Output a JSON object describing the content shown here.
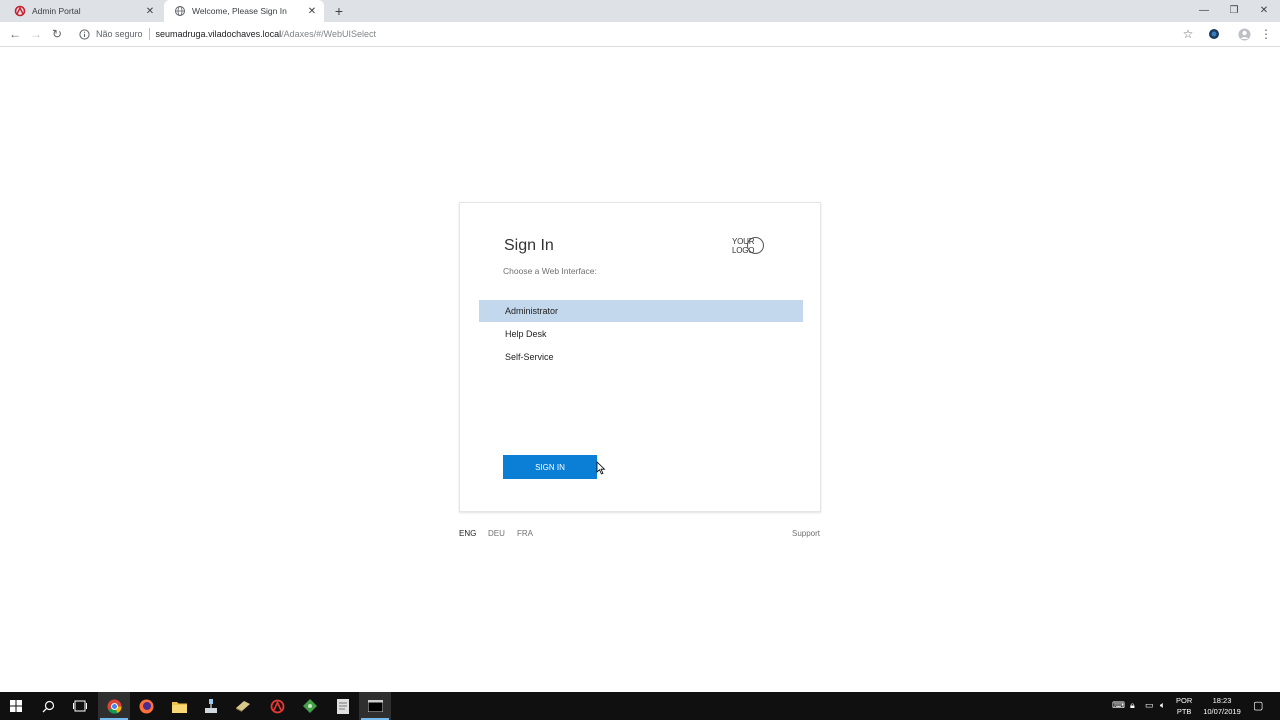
{
  "browser": {
    "tabs": [
      {
        "label": "Admin Portal",
        "icon": "adaxes-icon",
        "active": false
      },
      {
        "label": "Welcome, Please Sign In",
        "icon": "globe-icon",
        "active": true
      }
    ],
    "address": {
      "security_label": "Não seguro",
      "host": "seumadruga.viladochaves.local",
      "path": "/Adaxes/#/WebUISelect"
    }
  },
  "signin": {
    "title": "Sign In",
    "subtitle": "Choose a Web Interface:",
    "logo_text": "YOUR LOGO",
    "options": [
      {
        "label": "Administrator",
        "selected": true
      },
      {
        "label": "Help Desk",
        "selected": false
      },
      {
        "label": "Self-Service",
        "selected": false
      }
    ],
    "button_label": "SIGN IN",
    "selection_color": "#c3d8ec",
    "button_color": "#0b7fd6"
  },
  "footer": {
    "languages": [
      "ENG",
      "DEU",
      "FRA"
    ],
    "active_language": "ENG",
    "support_label": "Support"
  },
  "taskbar": {
    "input_language": [
      "POR",
      "PTB"
    ],
    "time": "18:23",
    "date": "10/07/2019"
  }
}
